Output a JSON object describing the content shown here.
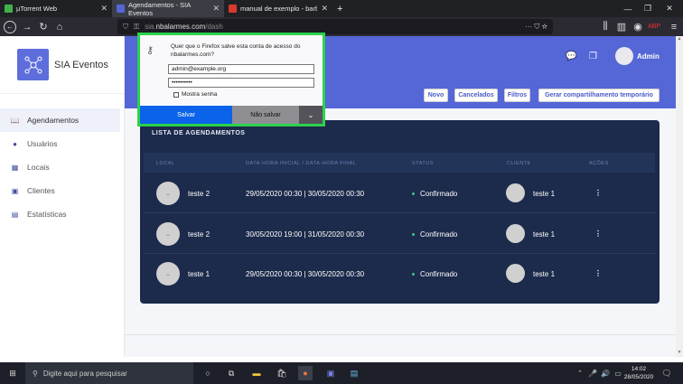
{
  "browser": {
    "tabs": [
      {
        "title": "µTorrent Web",
        "color": "#3fb24a"
      },
      {
        "title": "Agendamentos - SIA Eventos",
        "color": "#5566d7"
      },
      {
        "title": "manual de exemplo - barbose",
        "color": "#d93a2b"
      }
    ],
    "new_tab": "+",
    "url_prefix": "sia.",
    "url_domain": "nbalarmes.com",
    "url_path": "/dash"
  },
  "sidebar": {
    "brand": "SIA Eventos",
    "items": [
      {
        "label": "Agendamentos",
        "icon": "📖"
      },
      {
        "label": "Usuários",
        "icon": "●"
      },
      {
        "label": "Locais",
        "icon": "▦"
      },
      {
        "label": "Clientes",
        "icon": "▣"
      },
      {
        "label": "Estatísticas",
        "icon": "▤"
      }
    ]
  },
  "header": {
    "user_name": "Admin"
  },
  "actions": {
    "novo": "Novo",
    "cancelados": "Cancelados",
    "filtros": "Filtros",
    "gerar": "Gerar compartilhamento temporário"
  },
  "table": {
    "title": "LISTA DE AGENDAMENTOS",
    "columns": [
      "LOCAL",
      "DATA-HORA INICIAL / DATA-HORA FINAL",
      "STATUS",
      "CLIENTE",
      "AÇÕES"
    ],
    "rows": [
      {
        "local": "teste 2",
        "datas": "29/05/2020 00:30 | 30/05/2020 00:30",
        "status": "Confirmado",
        "cliente": "teste 1",
        "acoes": "⋮"
      },
      {
        "local": "teste 2",
        "datas": "30/05/2020 19:00 | 31/05/2020 00:30",
        "status": "Confirmado",
        "cliente": "teste 1",
        "acoes": "⋮"
      },
      {
        "local": "teste 1",
        "datas": "29/05/2020 00:30 | 30/05/2020 00:30",
        "status": "Confirmado",
        "cliente": "teste 1",
        "acoes": "⋮"
      }
    ]
  },
  "popup": {
    "question": "Quer que o Firefox salve esta conta de acesso do nbalarmes.com?",
    "username": "admin@example.org",
    "password": "••••••••••",
    "show_password": "Mostra senha",
    "save": "Salvar",
    "dont_save": "Não salvar",
    "dropdown": "⌄"
  },
  "taskbar": {
    "search_placeholder": "Digite aqui para pesquisar",
    "time": "14:02",
    "date": "28/05/2020"
  }
}
